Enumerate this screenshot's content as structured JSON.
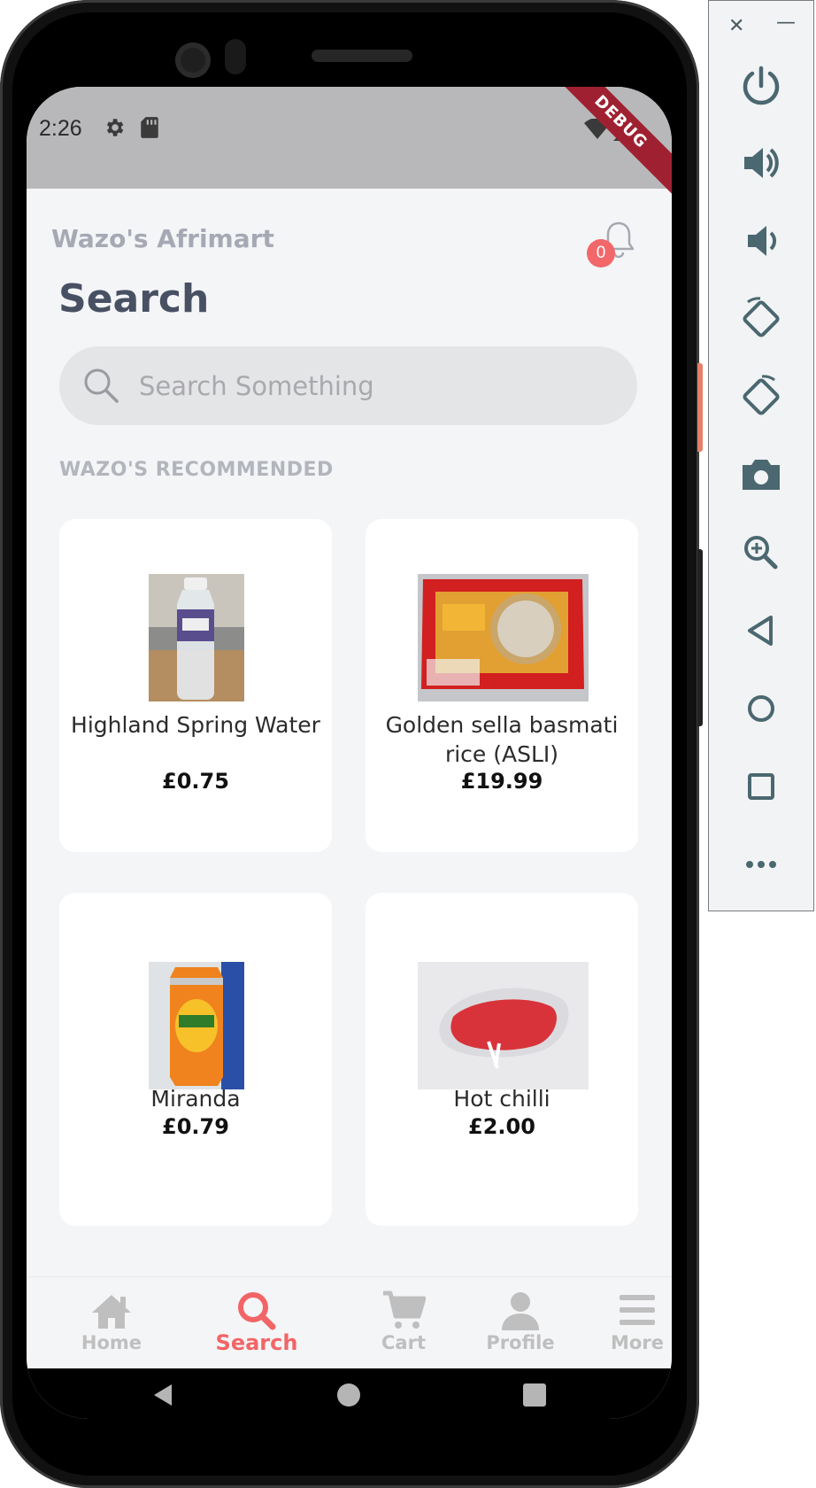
{
  "status_bar": {
    "time": "2:26",
    "debug_label": "DEBUG"
  },
  "app": {
    "store_name": "Wazo's Afrimart",
    "notification_count": "0",
    "page_title": "Search",
    "search": {
      "placeholder": "Search Something",
      "value": ""
    },
    "section_label": "WAZO'S RECOMMENDED"
  },
  "products": [
    {
      "name": "Highland Spring Water",
      "price": "£0.75",
      "image": "water-bottle"
    },
    {
      "name": "Golden sella basmati rice (ASLI)",
      "price": "£19.99",
      "image": "rice-bag"
    },
    {
      "name": "Miranda",
      "price": "£0.79",
      "image": "soda-can"
    },
    {
      "name": "Hot chilli",
      "price": "£2.00",
      "image": "chilli-bag"
    }
  ],
  "nav": {
    "items": [
      {
        "label": "Home",
        "icon": "home-icon",
        "active": false
      },
      {
        "label": "Search",
        "icon": "search-icon",
        "active": true
      },
      {
        "label": "Cart",
        "icon": "cart-icon",
        "active": false
      },
      {
        "label": "Profile",
        "icon": "profile-icon",
        "active": false
      },
      {
        "label": "More",
        "icon": "menu-icon",
        "active": false
      }
    ]
  },
  "colors": {
    "accent": "#f26566",
    "title": "#485063",
    "muted": "#a6a8b4",
    "background": "#f4f5f7"
  },
  "emulator_toolbar": {
    "window_controls": {
      "close": "✕",
      "minimize": "—"
    },
    "tools": [
      "power-icon",
      "volume-up-icon",
      "volume-down-icon",
      "rotate-left-icon",
      "rotate-right-icon",
      "camera-icon",
      "zoom-icon",
      "back-icon",
      "home-icon",
      "overview-icon",
      "more-icon"
    ]
  }
}
